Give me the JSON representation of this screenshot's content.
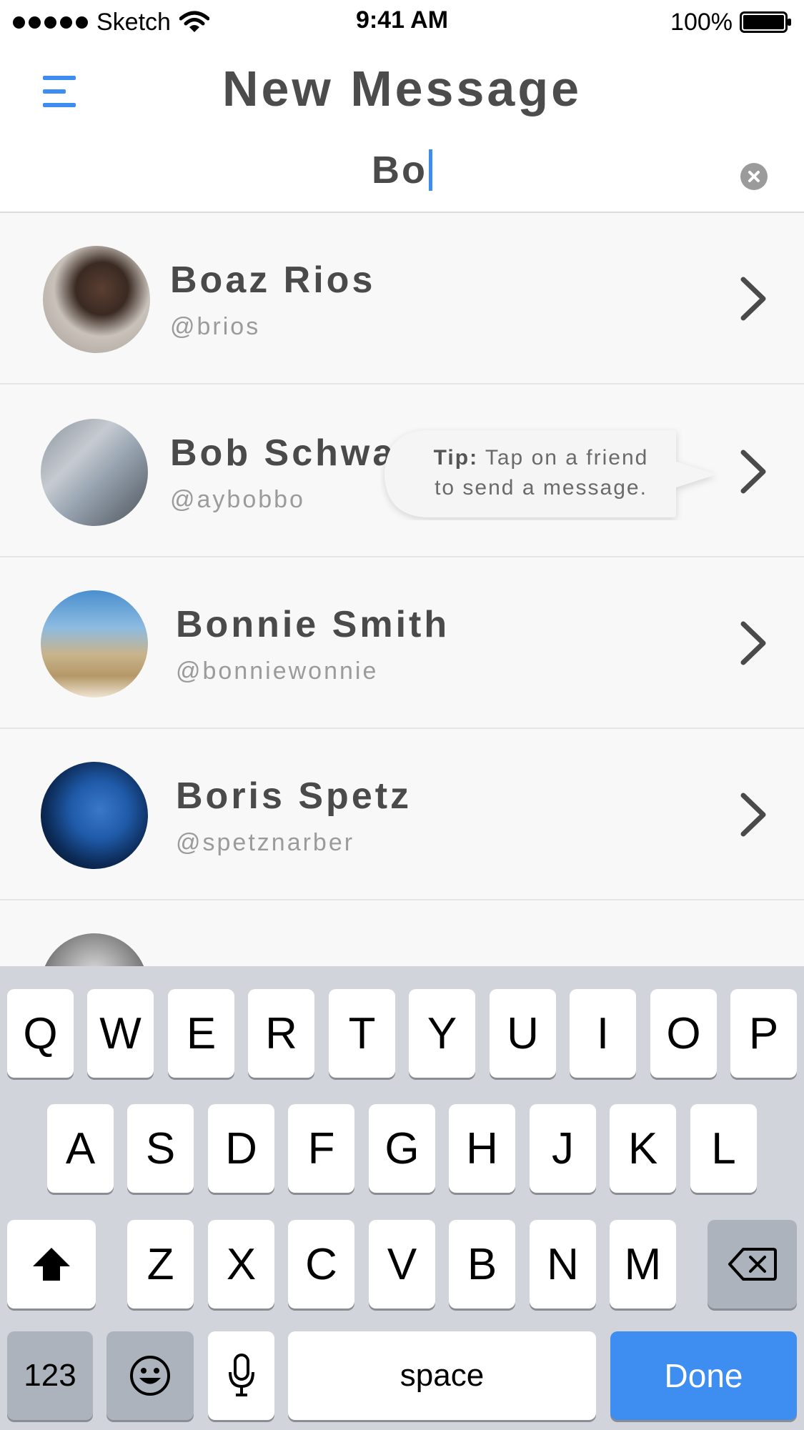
{
  "status_bar": {
    "carrier": "Sketch",
    "time": "9:41 AM",
    "battery": "100%",
    "signal_icon": "signal-dots-icon",
    "wifi_icon": "wifi-icon",
    "battery_icon": "battery-icon"
  },
  "header": {
    "title": "New Message",
    "menu_icon": "menu-icon",
    "accent_color": "#3d8ef0"
  },
  "search": {
    "value": "Bo",
    "clear_icon": "clear-icon"
  },
  "contacts": [
    {
      "name": "Boaz Rios",
      "handle": "@brios"
    },
    {
      "name": "Bob Schwa",
      "handle": "@aybobbo"
    },
    {
      "name": "Bonnie Smith",
      "handle": "@bonniewonnie"
    },
    {
      "name": "Boris Spetz",
      "handle": "@spetznarber"
    }
  ],
  "tip": {
    "label": "Tip:",
    "line1": "Tap on a friend",
    "line2": "to send a message."
  },
  "keyboard": {
    "row1": [
      "Q",
      "W",
      "E",
      "R",
      "T",
      "Y",
      "U",
      "I",
      "O",
      "P"
    ],
    "row2": [
      "A",
      "S",
      "D",
      "F",
      "G",
      "H",
      "J",
      "K",
      "L"
    ],
    "row3": [
      "Z",
      "X",
      "C",
      "V",
      "B",
      "N",
      "M"
    ],
    "numbers_label": "123",
    "space_label": "space",
    "done_label": "Done",
    "shift_icon": "shift-icon",
    "backspace_icon": "backspace-icon",
    "emoji_icon": "emoji-icon",
    "mic_icon": "microphone-icon"
  }
}
